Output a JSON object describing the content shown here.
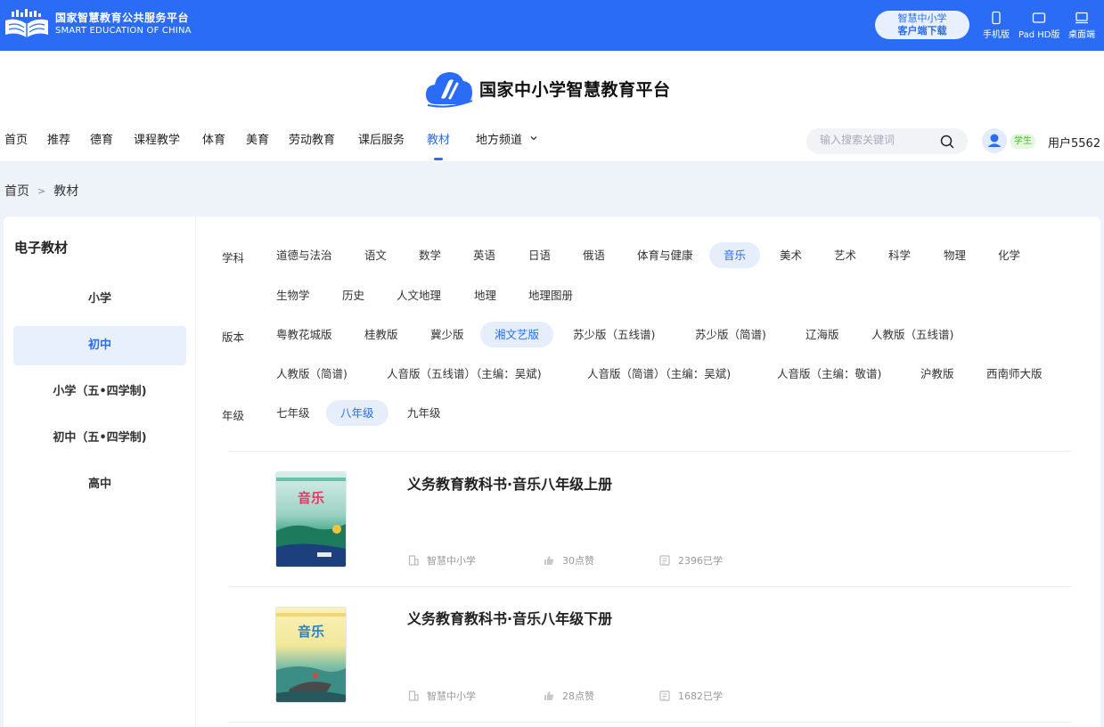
{
  "topbar": {
    "brand_cn": "国家智慧教育公共服务平台",
    "brand_en": "SMART EDUCATION OF CHINA",
    "download_line1": "智慧中小学",
    "download_line2": "客户端下载",
    "devices": [
      {
        "label": "手机版",
        "icon": "phone-icon"
      },
      {
        "label": "Pad HD版",
        "icon": "tablet-icon"
      },
      {
        "label": "桌面端",
        "icon": "desktop-icon"
      }
    ],
    "accent_color": "#2a6cf6"
  },
  "header": {
    "logo_text": "国家中小学智慧教育平台",
    "nav": [
      {
        "label": "首页"
      },
      {
        "label": "推荐"
      },
      {
        "label": "德育"
      },
      {
        "label": "课程教学"
      },
      {
        "label": "体育"
      },
      {
        "label": "美育"
      },
      {
        "label": "劳动教育"
      },
      {
        "label": "课后服务"
      },
      {
        "label": "教材",
        "active": true
      },
      {
        "label": "地方频道",
        "has_dropdown": true
      }
    ],
    "search_placeholder": "输入搜索关键词",
    "role_badge": "学生",
    "username": "用户5562"
  },
  "breadcrumb": [
    "首页",
    "教材"
  ],
  "sidebar": {
    "title": "电子教材",
    "items": [
      {
        "label": "小学"
      },
      {
        "label": "初中",
        "active": true
      },
      {
        "label": "小学（五•四学制)"
      },
      {
        "label": "初中（五•四学制)"
      },
      {
        "label": "高中"
      }
    ]
  },
  "filters": {
    "subject_label": "学科",
    "subjects": [
      "道德与法治",
      "语文",
      "数学",
      "英语",
      "日语",
      "俄语",
      "体育与健康",
      "音乐",
      "美术",
      "艺术",
      "科学",
      "物理",
      "化学",
      "生物学",
      "历史",
      "人文地理",
      "地理",
      "地理图册"
    ],
    "subject_selected": "音乐",
    "edition_label": "版本",
    "editions": [
      "粤教花城版",
      "桂教版",
      "冀少版",
      "湘文艺版",
      "苏少版（五线谱)",
      "苏少版（简谱)",
      "辽海版",
      "人教版（五线谱)",
      "人教版（简谱)",
      "人音版（五线谱）（主编：吴斌)",
      "人音版（简谱）（主编：吴斌)",
      "人音版（主编：敬谱)",
      "沪教版",
      "西南师大版"
    ],
    "edition_selected": "湘文艺版",
    "grade_label": "年级",
    "grades": [
      "七年级",
      "八年级",
      "九年级"
    ],
    "grade_selected": "八年级"
  },
  "books": [
    {
      "cover_title": "音乐",
      "title": "义务教育教科书·音乐八年级上册",
      "source": "智慧中小学",
      "likes": "30点赞",
      "learners": "2396已学"
    },
    {
      "cover_title": "音乐",
      "title": "义务教育教科书·音乐八年级下册",
      "source": "智慧中小学",
      "likes": "28点赞",
      "learners": "1682已学"
    }
  ]
}
